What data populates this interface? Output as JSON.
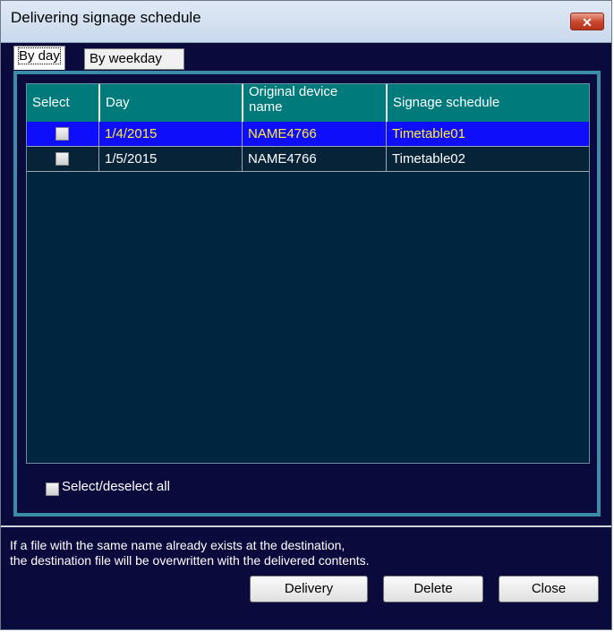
{
  "window": {
    "title": "Delivering signage schedule",
    "close_glyph": "✕"
  },
  "tabs": [
    {
      "label": "By day"
    },
    {
      "label": "By weekday"
    }
  ],
  "grid": {
    "columns": [
      "Select",
      "Day",
      "Original device name",
      "Signage schedule"
    ],
    "rows": [
      {
        "selected": true,
        "checked": false,
        "day": "1/4/2015",
        "device": "NAME4766",
        "schedule": "Timetable01"
      },
      {
        "selected": false,
        "checked": false,
        "day": "1/5/2015",
        "device": "NAME4766",
        "schedule": "Timetable02"
      }
    ]
  },
  "select_all": {
    "label": "Select/deselect all",
    "checked": false
  },
  "note": {
    "line1": "If a file with the same name already exists at the destination,",
    "line2": "the destination file will be overwritten with the delivered contents."
  },
  "buttons": {
    "delivery": "Delivery",
    "delete": "Delete",
    "close": "Close"
  },
  "colors": {
    "background": "#0a0a3c",
    "header": "#007a7a",
    "selected_row": "#0e0efa",
    "selected_text": "#ffee33"
  }
}
